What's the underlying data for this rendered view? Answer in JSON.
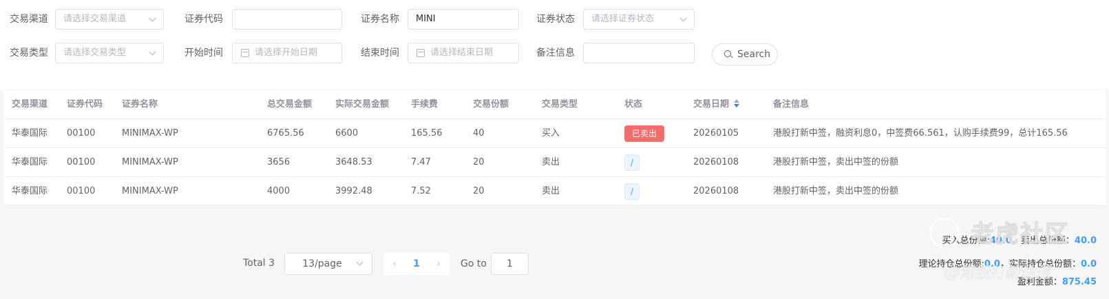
{
  "filters": {
    "channel": {
      "label": "交易渠道",
      "placeholder": "请选择交易渠道"
    },
    "code": {
      "label": "证券代码",
      "value": ""
    },
    "name": {
      "label": "证券名称",
      "value": "MINI"
    },
    "status": {
      "label": "证券状态",
      "placeholder": "请选择证券状态"
    },
    "type": {
      "label": "交易类型",
      "placeholder": "请选择交易类型"
    },
    "start": {
      "label": "开始时间",
      "placeholder": "请选择开始日期"
    },
    "end": {
      "label": "结束时间",
      "placeholder": "请选择结束日期"
    },
    "remark": {
      "label": "备注信息",
      "value": ""
    },
    "search_label": "Search"
  },
  "table": {
    "headers": [
      "交易渠道",
      "证券代码",
      "证券名称",
      "总交易金额",
      "实际交易金额",
      "手续费",
      "交易份额",
      "交易类型",
      "状态",
      "交易日期",
      "备注信息"
    ],
    "rows": [
      {
        "channel": "华泰国际",
        "code": "00100",
        "name": "MINIMAX-WP",
        "total": "6765.56",
        "actual": "6600",
        "fee": "165.56",
        "shares": "40",
        "type": "买入",
        "status": "已卖出",
        "status_style": "red",
        "date": "20260105",
        "remark": "港股打新中签，融资利息0，中签费66.561，认购手续费99，总计165.56"
      },
      {
        "channel": "华泰国际",
        "code": "00100",
        "name": "MINIMAX-WP",
        "total": "3656",
        "actual": "3648.53",
        "fee": "7.47",
        "shares": "20",
        "type": "卖出",
        "status": "/",
        "status_style": "blue",
        "date": "20260108",
        "remark": "港股打新中签，卖出中签的份额"
      },
      {
        "channel": "华泰国际",
        "code": "00100",
        "name": "MINIMAX-WP",
        "total": "4000",
        "actual": "3992.48",
        "fee": "7.52",
        "shares": "20",
        "type": "卖出",
        "status": "/",
        "status_style": "blue",
        "date": "20260108",
        "remark": "港股打新中签，卖出中签的份额"
      }
    ]
  },
  "pagination": {
    "total": "Total 3",
    "page_size": "13/page",
    "current_page": "1",
    "goto_label": "Go to",
    "goto_value": "1"
  },
  "summary": {
    "buy_label": "买入总份额:",
    "buy_value": "40.0",
    "sell_label": "，卖出总份额：",
    "sell_value": "40.0",
    "theory_label": "理论持仓总份额:",
    "theory_value": "0.0",
    "actual_label": "，实际持仓总份额：",
    "actual_value": "0.0",
    "profit_label": "盈利金额：",
    "profit_value": "875.45"
  },
  "watermark": {
    "title": "老虎社区",
    "subtitle": "@港股打新估值"
  },
  "colors": {
    "accent": "#409eff",
    "danger": "#f56c6c",
    "background": "#f6f6f6"
  }
}
